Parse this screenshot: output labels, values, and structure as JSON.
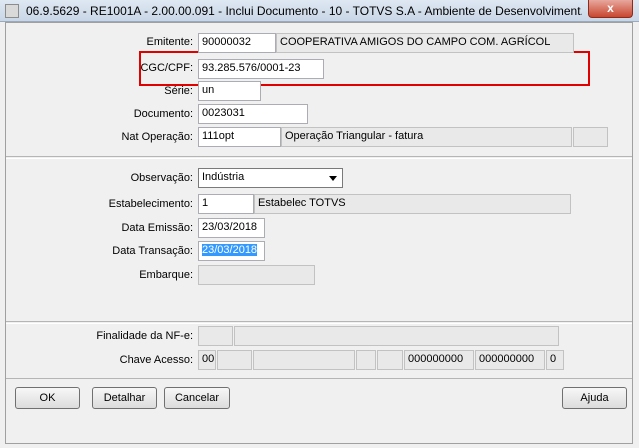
{
  "window": {
    "title": "06.9.5629 - RE1001A - 2.00.00.091 - Inclui Documento - 10 - TOTVS S.A - Ambiente de Desenvolviment...",
    "close": "x"
  },
  "form": {
    "emitente_label": "Emitente:",
    "emitente_code": "90000032",
    "emitente_name": "COOPERATIVA AMIGOS DO CAMPO COM. AGRÍCOL",
    "cgc_label": "CGC/CPF:",
    "cgc_value": "93.285.576/0001-23",
    "serie_label": "Série:",
    "serie_value": "un",
    "documento_label": "Documento:",
    "documento_value": "0023031",
    "natop_label": "Nat Operação:",
    "natop_code": "111opt",
    "natop_desc": "Operação Triangular - fatura",
    "obs_label": "Observação:",
    "obs_value": "Indústria",
    "estab_label": "Estabelecimento:",
    "estab_code": "1",
    "estab_desc": "Estabelec TOTVS",
    "emissao_label": "Data Emissão:",
    "emissao_value": "23/03/2018",
    "transacao_label": "Data Transação:",
    "transacao_value": "23/03/2018",
    "embarque_label": "Embarque:",
    "embarque_value": "",
    "finalidade_label": "Finalidade da NF-e:",
    "chave_label": "Chave Acesso:",
    "chave_prefix": "00",
    "chave_a": "000000000",
    "chave_b": "000000000",
    "chave_c": "0"
  },
  "buttons": {
    "ok": "OK",
    "detalhar": "Detalhar",
    "cancelar": "Cancelar",
    "ajuda": "Ajuda"
  }
}
